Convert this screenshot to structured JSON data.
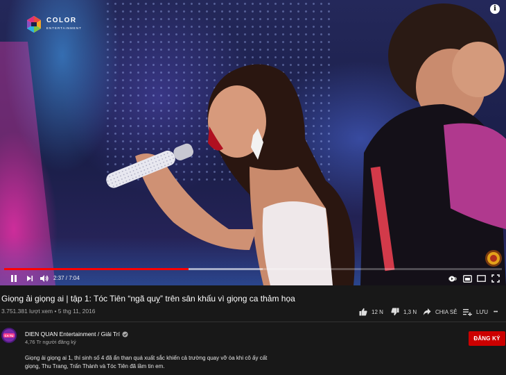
{
  "player": {
    "logo_title": "COLOR",
    "logo_subtitle": "ENTERTAINMENT",
    "info_glyph": "i",
    "current_time": "2:37",
    "duration": "7:04",
    "time_text": "2:37 / 7:04",
    "progress_played": 0.37,
    "progress_loaded": 0.52,
    "accent_color": "#ff0000",
    "icons": [
      "play-pause-icon",
      "next-icon",
      "volume-icon",
      "autoplay-icon",
      "subtitles-icon",
      "settings-icon",
      "miniplayer-icon",
      "theater-icon",
      "fullscreen-icon"
    ]
  },
  "video": {
    "title": "Giọng ải giọng ai | tập 1: Tóc Tiên “ngã quỵ” trên sân khấu vì giọng ca thảm họa",
    "views": "3.751.381 lượt xem",
    "date": "5 thg 11, 2016",
    "meta_text": "3.751.381 lượt xem • 5 thg 11, 2016"
  },
  "actions": {
    "like_count": "12 N",
    "dislike_count": "1,3 N",
    "share_label": "CHIA SẺ",
    "save_label": "LƯU",
    "more_glyph": "•••"
  },
  "channel": {
    "name": "DIEN QUAN Entertainment / Giải Trí",
    "subscribers": "4,76 Tr người đăng ký",
    "subscribe_label": "ĐĂNG KÝ",
    "subscribe_color": "#cc0000",
    "avatar_text": "CA TU"
  },
  "description": {
    "line1": "Giọng ải giọng ai 1, thí sinh số 4 đã ẩn than quá xuất sắc khiến cả trường quay vỡ òa khi cô ấy cất",
    "line2": "giọng, Thu Trang, Trấn Thành và Tóc Tiên đã lầm tin em."
  }
}
